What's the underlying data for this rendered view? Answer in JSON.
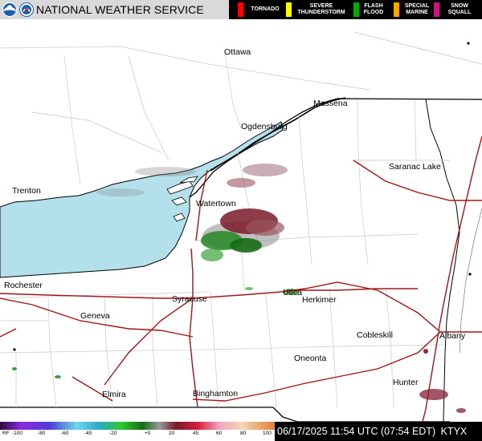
{
  "header": {
    "title": "NATIONAL WEATHER SERVICE",
    "warnings": [
      {
        "label": "TORNADO",
        "color": "#ff0000"
      },
      {
        "label": "SEVERE THUNDERSTORM",
        "color": "#ffff00"
      },
      {
        "label": "FLASH FLOOD",
        "color": "#00aa00"
      },
      {
        "label": "SPECIAL MARINE",
        "color": "#ffa500"
      },
      {
        "label": "SNOW SQUALL",
        "color": "#c71585"
      }
    ]
  },
  "map": {
    "cities": [
      "Ottawa",
      "Massena",
      "Ogdensburg",
      "Saranac Lake",
      "Trenton",
      "Watertown",
      "Rochester",
      "Syracuse",
      "Utica",
      "Herkimer",
      "Geneva",
      "Cobleskill",
      "Albany",
      "Oneonta",
      "Hunter",
      "Elmira",
      "Binghamton"
    ],
    "water_color": "#b4e0ec",
    "road_color": "#a31515"
  },
  "footer": {
    "colorbar_labels": [
      "RF",
      "-100",
      "-80",
      "-60",
      "-45",
      "-20",
      "+0",
      "20",
      "45",
      "60",
      "80",
      "100"
    ],
    "timestamp": "06/17/2025 11:54 UTC (07:54 EDT)",
    "station": "KTYX"
  }
}
